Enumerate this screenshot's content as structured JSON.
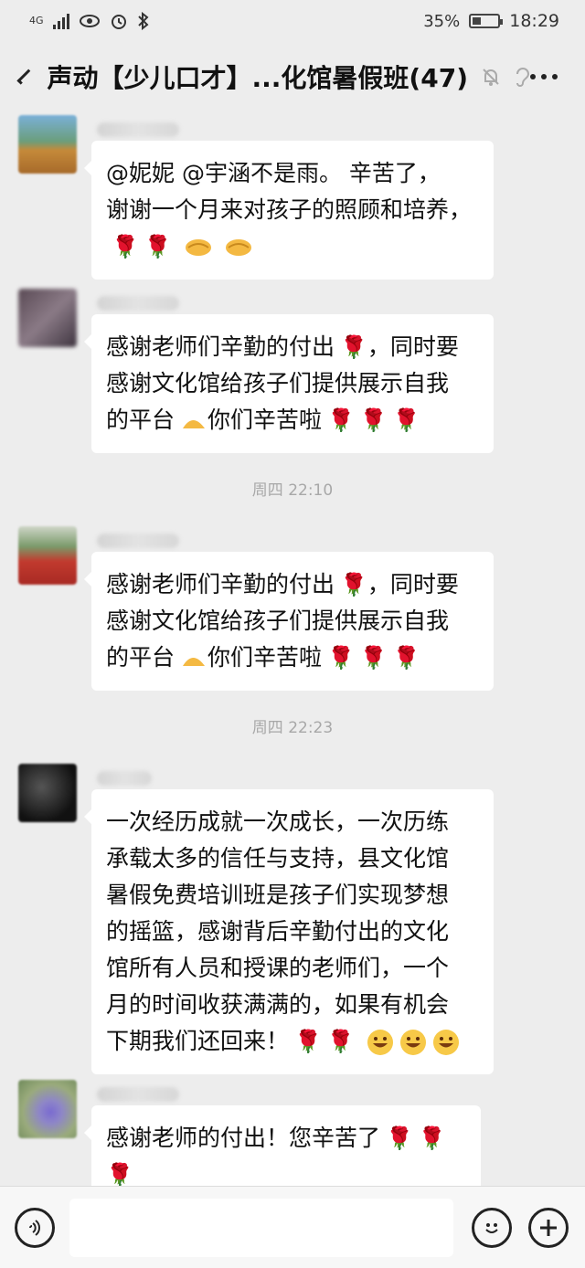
{
  "status_bar": {
    "network": "4G",
    "battery": "35%",
    "battery_level": 0.35,
    "time": "18:29"
  },
  "header": {
    "title": "声动【少儿口才】...化馆暑假班(47)",
    "icons": [
      "back-icon",
      "mute-bell-icon",
      "ear-icon",
      "more-icon"
    ]
  },
  "messages": [
    {
      "text": "@妮妮 @宇涵不是雨。 辛苦了，谢谢一个月来对孩子的照顾和培养，",
      "emojis": [
        "rose",
        "rose",
        "handshake",
        "handshake"
      ]
    },
    {
      "text": "感谢老师们辛勤的付出🌹，同时要感谢文化馆给孩子们提供展示自我的平台👌你们辛苦啦",
      "emojis": [
        "rose",
        "rose",
        "rose"
      ]
    },
    {
      "timestamp": "周四 22:10"
    },
    {
      "text": "感谢老师们辛勤的付出🌹，同时要感谢文化馆给孩子们提供展示自我的平台👌你们辛苦啦",
      "emojis": [
        "rose",
        "rose",
        "rose"
      ]
    },
    {
      "timestamp": "周四 22:23"
    },
    {
      "text": "一次经历成就一次成长，一次历练承载太多的信任与支持，县文化馆暑假免费培训班是孩子们实现梦想的摇篮，感谢背后辛勤付出的文化馆所有人员和授课的老师们，一个月的时间收获满满的，如果有机会下期我们还回来！",
      "emojis": [
        "rose",
        "rose",
        "grin",
        "grin",
        "grin"
      ]
    },
    {
      "text": "感谢老师的付出！您辛苦了",
      "emojis": [
        "rose",
        "rose",
        "rose"
      ]
    }
  ],
  "bubble_lines": {
    "m1": [
      "@妮妮  @宇涵不是雨。 辛苦了，",
      "谢谢一个月来对孩子的照顾和培养，"
    ],
    "m2": [
      "感谢老师们辛勤的付出",
      "，同时要",
      "感谢文化馆给孩子们提供展示自我",
      "的平台",
      "你们辛苦啦"
    ],
    "m3": [
      "感谢老师们辛勤的付出",
      "，同时要",
      "感谢文化馆给孩子们提供展示自我",
      "的平台",
      "你们辛苦啦"
    ],
    "m4": [
      "一次经历成就一次成长，一次历练",
      "承载太多的信任与支持，县文化馆",
      "暑假免费培训班是孩子们实现梦想",
      "的摇篮，感谢背后辛勤付出的文化",
      "馆所有人员和授课的老师们，一个",
      "月的时间收获满满的，如果有机会",
      "下期我们还回来！"
    ],
    "m5": [
      "感谢老师的付出！您辛苦了"
    ]
  },
  "timestamps": {
    "t1": "周四 22:10",
    "t2": "周四 22:23"
  },
  "colors": {
    "background": "#ededed",
    "bubble": "#ffffff",
    "rose": "#c4161c"
  }
}
